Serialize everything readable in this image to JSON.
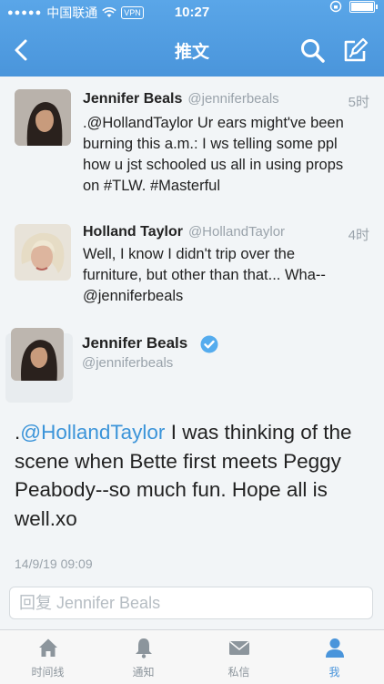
{
  "status_bar": {
    "carrier": "中国联通",
    "vpn": "VPN",
    "time": "10:27"
  },
  "nav": {
    "title": "推文"
  },
  "tweets": [
    {
      "name": "Jennifer Beals",
      "handle": "@jenniferbeals",
      "time": "5时",
      "text": ".@HollandTaylor Ur ears might've been burning this a.m.: I ws telling some ppl how u jst schooled us all in using props on #TLW. #Masterful"
    },
    {
      "name": "Holland Taylor",
      "handle": "@HollandTaylor",
      "time": "4时",
      "text": "Well, I know I didn't trip over the furniture, but other than that... Wha--@jenniferbeals"
    }
  ],
  "detail": {
    "name": "Jennifer Beals",
    "handle": "@jenniferbeals",
    "prefix": ".",
    "mention": "@HollandTaylor",
    "text": " I was thinking of the scene when Bette first meets Peggy Peabody--so much fun. Hope all is well.xo",
    "timestamp": "14/9/19 09:09"
  },
  "reply": {
    "placeholder": "回复 Jennifer Beals"
  },
  "tabs": [
    {
      "label": "时间线",
      "icon": "home-icon"
    },
    {
      "label": "通知",
      "icon": "bell-icon"
    },
    {
      "label": "私信",
      "icon": "mail-icon"
    },
    {
      "label": "我",
      "icon": "person-icon",
      "active": true
    }
  ],
  "colors": {
    "bar": "#4a95db",
    "link": "#3b94d9",
    "verified": "#55acee"
  }
}
